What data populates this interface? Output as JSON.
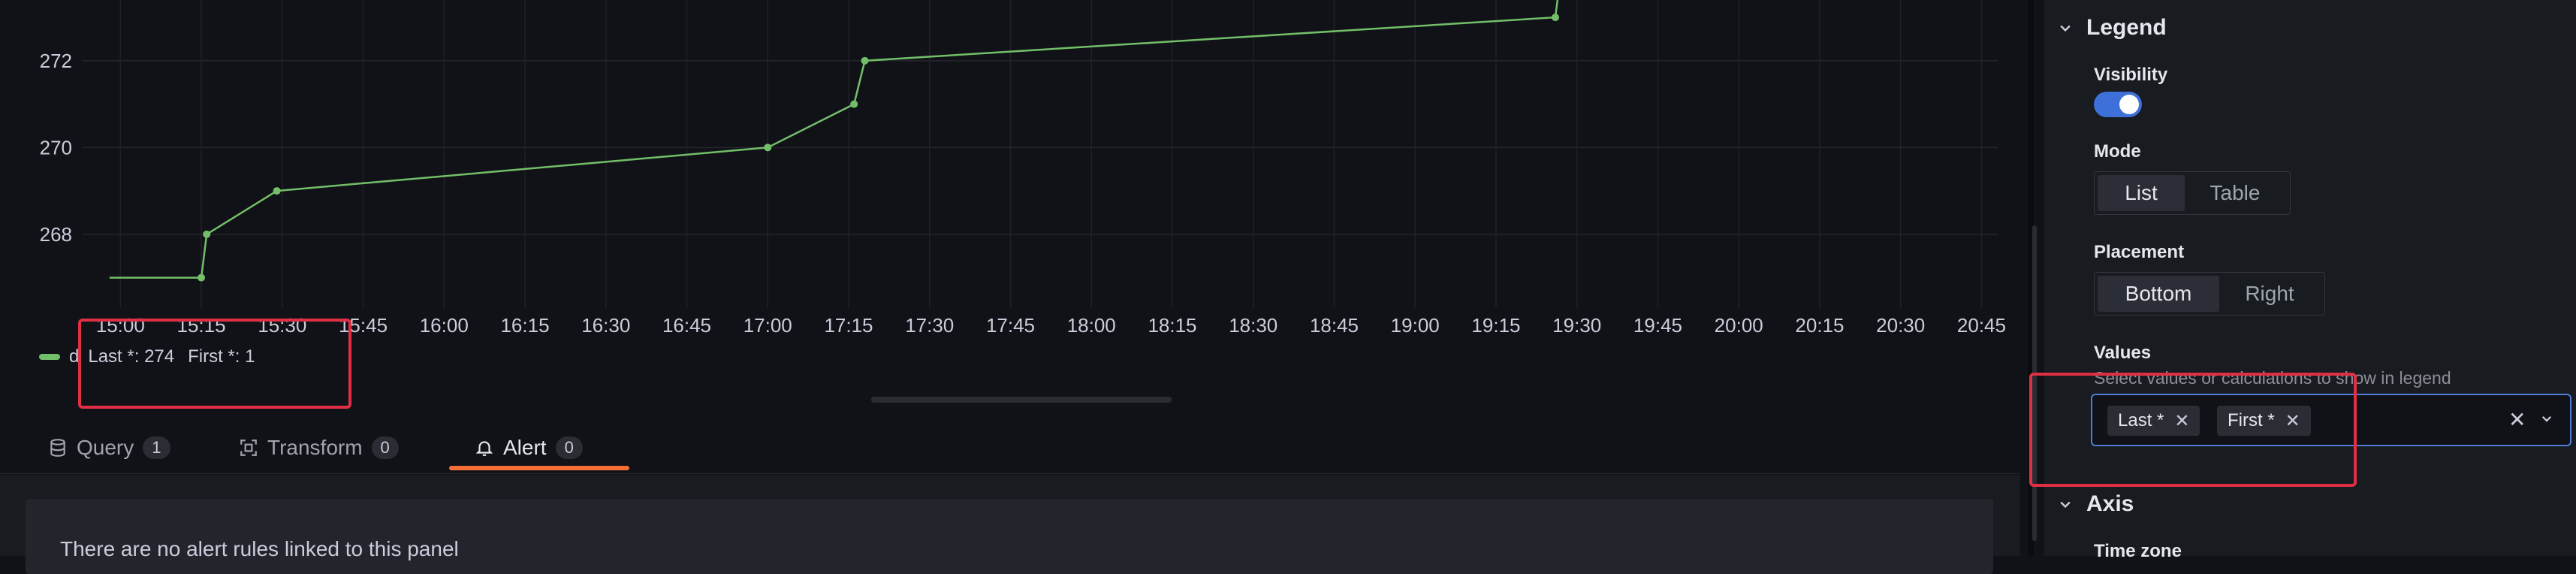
{
  "chart_data": {
    "type": "line",
    "x": [
      "14:58",
      "15:15",
      "15:16",
      "15:29",
      "17:00",
      "17:16",
      "17:18",
      "19:26",
      "19:27"
    ],
    "series": [
      {
        "values": [
          267,
          267,
          268,
          269,
          270,
          271,
          272,
          273,
          274
        ]
      }
    ],
    "x_ticks": [
      "15:00",
      "15:15",
      "15:30",
      "15:45",
      "16:00",
      "16:15",
      "16:30",
      "16:45",
      "17:00",
      "17:15",
      "17:30",
      "17:45",
      "18:00",
      "18:15",
      "18:30",
      "18:45",
      "19:00",
      "19:15",
      "19:30",
      "19:45",
      "20:00",
      "20:15",
      "20:30",
      "20:45"
    ],
    "y_ticks": [
      268,
      270,
      272
    ],
    "x_range": [
      "14:53",
      "20:48"
    ],
    "ylim": [
      266.3,
      273.4
    ],
    "grid": true,
    "line_color": "#73bf69"
  },
  "legend": {
    "series_label": "d",
    "last": "Last *: 274",
    "first": "First *: 1"
  },
  "tabs": [
    {
      "label": "Query",
      "count": "1",
      "icon": "database-icon"
    },
    {
      "label": "Transform",
      "count": "0",
      "icon": "transform-icon"
    },
    {
      "label": "Alert",
      "count": "0",
      "icon": "bell-icon"
    }
  ],
  "alert": {
    "empty_text": "There are no alert rules linked to this panel"
  },
  "options": {
    "legend_title": "Legend",
    "visibility_label": "Visibility",
    "mode_label": "Mode",
    "mode_options": [
      "List",
      "Table"
    ],
    "mode_selected": "List",
    "placement_label": "Placement",
    "placement_options": [
      "Bottom",
      "Right"
    ],
    "placement_selected": "Bottom",
    "values_label": "Values",
    "values_desc": "Select values or calculations to show in legend",
    "values_selected": [
      "Last *",
      "First *"
    ],
    "axis_title": "Axis",
    "timezone_label": "Time zone"
  },
  "colors": {
    "accent": "#3d71d9",
    "series": "#73bf69",
    "alert_tab": "#f66e35",
    "highlight": "#e02f44"
  }
}
